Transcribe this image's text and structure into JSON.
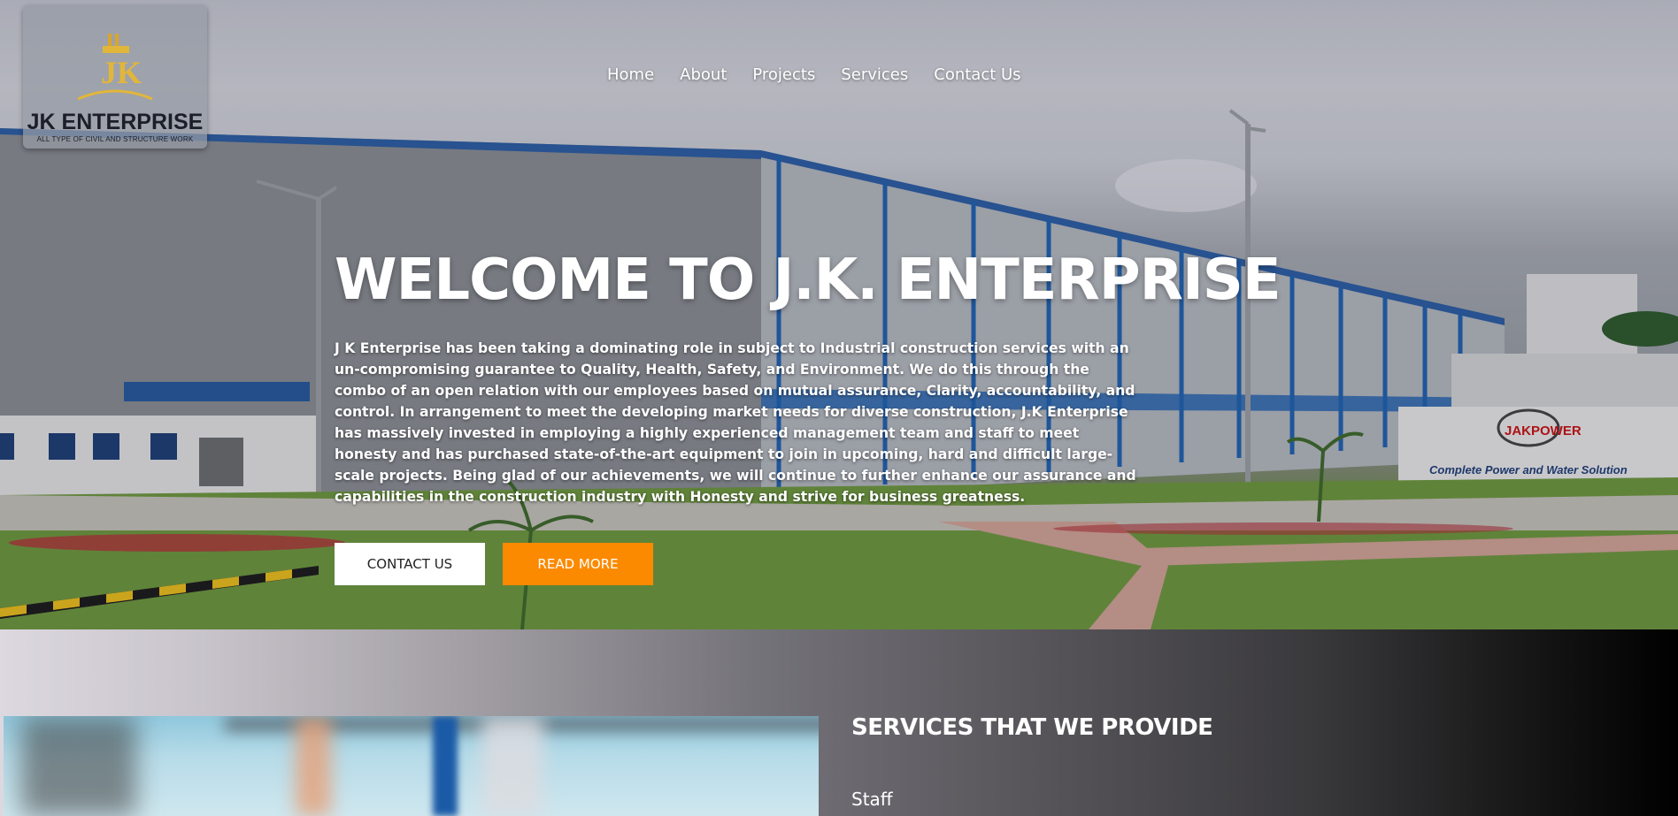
{
  "brand": {
    "name": "JK ENTERPRISE",
    "tagline": "ALL TYPE OF CIVIL AND STRUCTURE WORK",
    "logo_letters": "JK"
  },
  "nav": {
    "items": [
      {
        "label": "Home"
      },
      {
        "label": "About"
      },
      {
        "label": "Projects"
      },
      {
        "label": "Services"
      },
      {
        "label": "Contact Us"
      }
    ]
  },
  "hero": {
    "title": "WELCOME TO J.K. ENTERPRISE",
    "body": "J K Enterprise has been taking a dominating role in subject to Industrial construction services with an un-compromising guarantee to Quality, Health, Safety, and Environment. We do this through the combo of an open relation with our employees based on mutual assurance, Clarity, accountability, and control. In arrangement to meet the developing market needs for diverse construction, J.K Enterprise has massively invested in employing a highly experienced management team and staff to meet honesty and has purchased state-of-the-art equipment to join in upcoming, hard and difficult large- scale projects. Being glad of our achievements, we will continue to further enhance our assurance and capabilities in the construction industry with Honesty and strive for business greatness.",
    "contact_button": "CONTACT US",
    "read_more_button": "READ MORE",
    "sign_brand": "JAKPOWER",
    "sign_text": "Complete Power and Water Solution"
  },
  "services": {
    "title": "SERVICES THAT WE PROVIDE",
    "first_item": "Staff"
  },
  "colors": {
    "accent": "#fb8a00",
    "logo_gold": "#e2b63a",
    "building_blue": "#1f63b4"
  }
}
